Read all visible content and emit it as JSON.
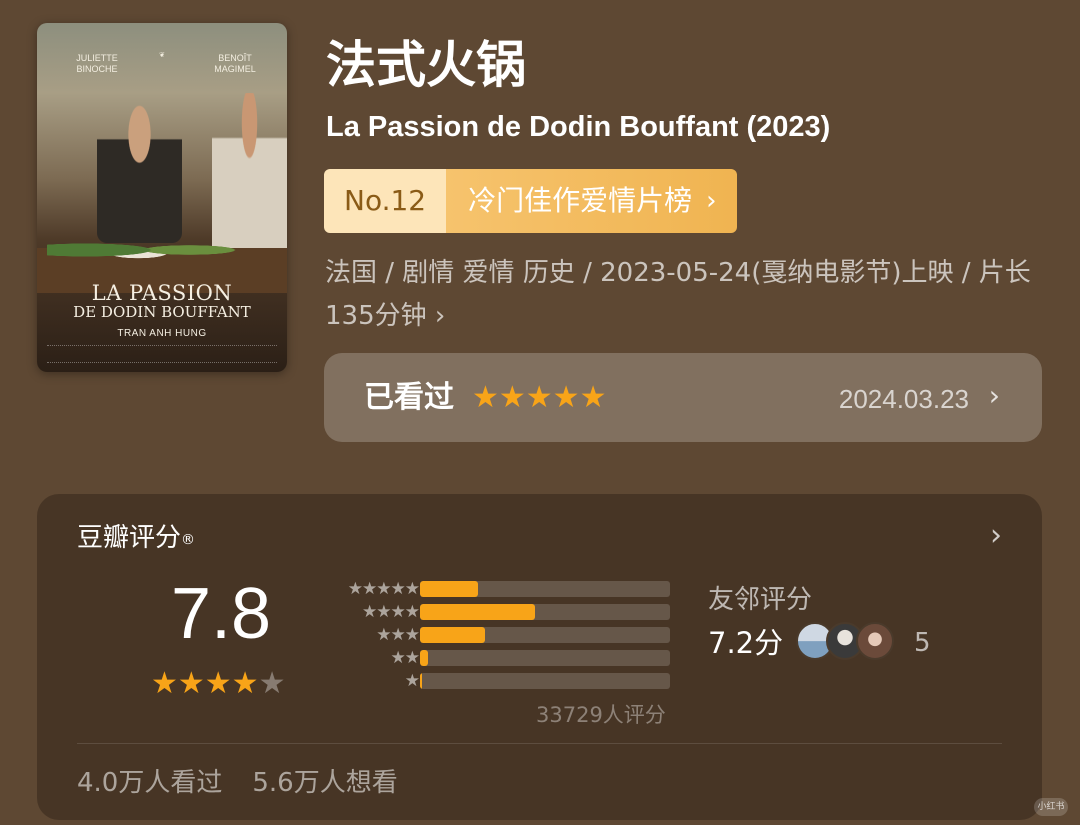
{
  "poster": {
    "actor_left": "JULIETTE\nBINOCHE",
    "actor_right": "BENOÎT\nMAGIMEL",
    "title_line1": "LA PASSION",
    "title_line2": "DE DODIN BOUFFANT",
    "director": "TRAN ANH HUNG"
  },
  "movie": {
    "title_cn": "法式火锅",
    "title_en": "La Passion de Dodin Bouffant (2023)",
    "rank_no": "No.12",
    "rank_list": "冷门佳作爱情片榜",
    "meta": "法国 / 剧情 爱情 历史 / 2023-05-24(戛纳电影节)上映 / 片长135分钟"
  },
  "watched": {
    "label": "已看过",
    "stars": "★★★★★",
    "rating_value": 5,
    "date": "2024.03.23"
  },
  "rating": {
    "heading": "豆瓣评分",
    "reg_mark": "®",
    "score": "7.8",
    "stars_on": "★★★★",
    "stars_off": "★",
    "distribution": [
      {
        "stars": "★★★★★",
        "fraction": 0.23
      },
      {
        "stars": "★★★★",
        "fraction": 0.46
      },
      {
        "stars": "★★★",
        "fraction": 0.26
      },
      {
        "stars": "★★",
        "fraction": 0.03
      },
      {
        "stars": "★",
        "fraction": 0.005
      }
    ],
    "count": "33729人评分",
    "friends_label": "友邻评分",
    "friends_score": "7.2分",
    "friends_count": "5",
    "seen": "4.0万人看过",
    "want": "5.6万人想看"
  },
  "icons": {
    "chevron": "›"
  },
  "watermark": "小红书"
}
